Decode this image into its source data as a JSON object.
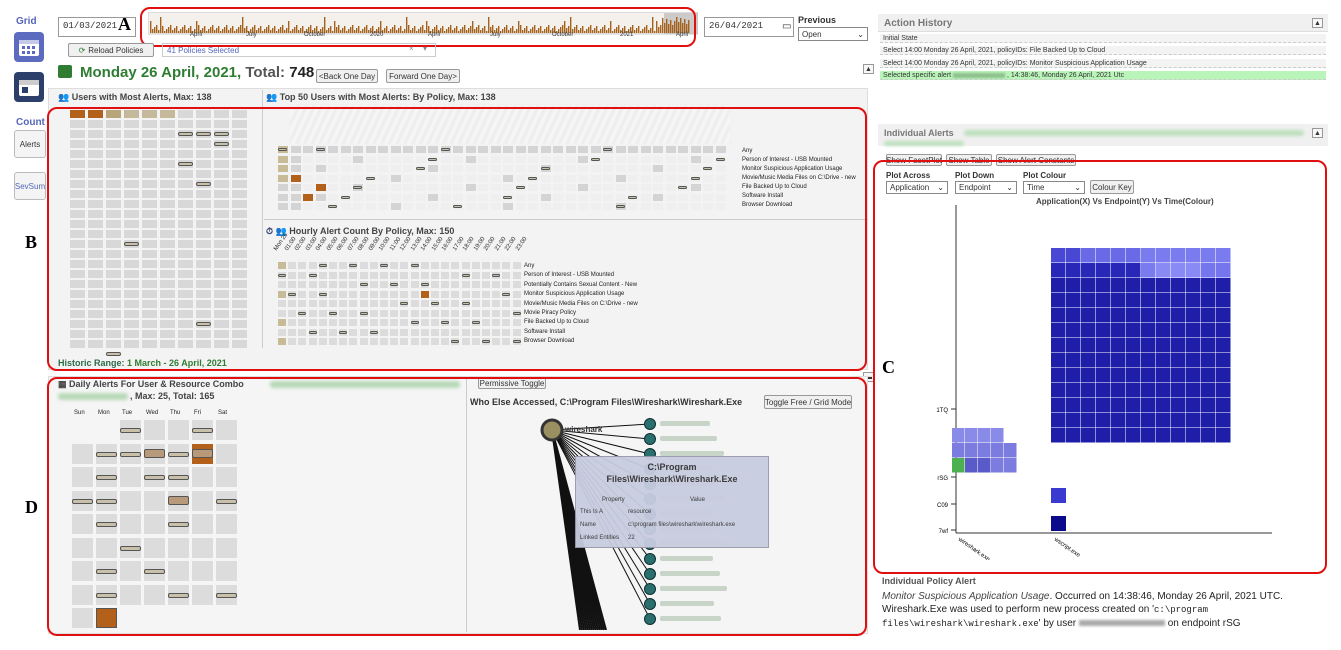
{
  "sidebar": {
    "grid_label": "Grid",
    "count_label": "Count",
    "alerts_label": "Alerts",
    "sevsum_label": "SevSum"
  },
  "timeline": {
    "start_date": "01/03/2021",
    "end_date": "26/04/2021",
    "marker_A": "A",
    "ticks": [
      "April",
      "July",
      "October",
      "2020",
      "April",
      "July",
      "October",
      "2021",
      "April"
    ],
    "previous_label": "Previous",
    "previous_value": "Open"
  },
  "toolbar": {
    "reload_label": "Reload Policies",
    "policies_selected": "41 Policies Selected",
    "clear_x": "×"
  },
  "day": {
    "title": "Monday 26 April, 2021,",
    "total_label": "Total:",
    "total": "748",
    "back_label": "<Back One Day",
    "forward_label": "Forward One Day>"
  },
  "panelB": {
    "marker": "B",
    "users_title": "Users with Most Alerts, Max:",
    "users_max": "138",
    "top50_title": "Top 50 Users with Most Alerts: By Policy, Max:",
    "top50_max": "138",
    "top50_policies": [
      "Any",
      "Person of Interest - USB Mounted",
      "Monitor Suspicious Application Usage",
      "Movie/Music Media Files on C:\\Drive - new",
      "File Backed Up to Cloud",
      "Software Install",
      "Browser Download"
    ],
    "hourly_title": "Hourly Alert Count By Policy, Max:",
    "hourly_max": "150",
    "hours": [
      "Mon 26",
      "01:00",
      "02:00",
      "03:00",
      "04:00",
      "05:00",
      "06:00",
      "07:00",
      "08:00",
      "09:00",
      "10:00",
      "11:00",
      "12:00",
      "13:00",
      "14:00",
      "15:00",
      "16:00",
      "17:00",
      "18:00",
      "19:00",
      "20:00",
      "21:00",
      "22:00",
      "23:00"
    ],
    "hourly_policies": [
      "Any",
      "Person of Interest - USB Mounted",
      "Potentially Contains Sexual Content - New",
      "Monitor Suspicious Application Usage",
      "Movie/Music Media Files on C:\\Drive - new",
      "Movie Piracy Policy",
      "File Backed Up to Cloud",
      "Software Install",
      "Browser Download"
    ],
    "historic_label": "Historic Range:",
    "historic_range": "1 March - 26 April, 2021"
  },
  "panelD": {
    "marker": "D",
    "title": "Daily Alerts For User & Resource Combo",
    "max_label": ", Max:",
    "max": "25",
    "total_label": ", Total:",
    "total": "165",
    "days": [
      "Sun",
      "Mon",
      "Tue",
      "Wed",
      "Thu",
      "Fri",
      "Sat"
    ],
    "permissive_label": "Permissive Toggle",
    "who_title": "Who Else Accessed, C:\\Program Files\\Wireshark\\Wireshark.Exe",
    "toggle_label": "Toggle Free / Grid Mode",
    "node_label": "wireshark",
    "tooltip": {
      "title": "C:\\Program Files\\Wireshark\\Wireshark.Exe",
      "prop_h": "Property",
      "val_h": "Value",
      "rows": [
        {
          "k": "This Is A",
          "v": "resource"
        },
        {
          "k": "Name",
          "v": "c:\\program files\\wireshark\\wireshark.exe"
        },
        {
          "k": "Linked Entities",
          "v": "22"
        }
      ]
    }
  },
  "history": {
    "title": "Action History",
    "items": [
      "Initial State",
      "Select 14:00 Monday 26 April, 2021, policyIDs: File Backed Up to Cloud",
      "Select 14:00 Monday 26 April, 2021, policyIDs: Monitor Suspicious Application Usage",
      "Selected specific alert",
      ", 14:38:46, Monday 26 April, 2021 Utc"
    ]
  },
  "individual": {
    "title": "Individual Alerts",
    "tabs": [
      "Show FacetPlot",
      "Show Table",
      "Show Alert Constants"
    ],
    "plot_across_label": "Plot Across",
    "plot_across": "Application",
    "plot_down_label": "Plot Down",
    "plot_down": "Endpoint",
    "plot_colour_label": "Plot Colour",
    "plot_colour": "Time",
    "colour_key": "Colour Key",
    "chart_title": "Application(X) Vs Endpoint(Y) Vs Time(Colour)",
    "y_ticks": [
      "1TQ",
      "rSG",
      "C09",
      "7wf"
    ],
    "x_ticks": [
      "wireshark.exe",
      "wscript.exe"
    ],
    "marker": "C"
  },
  "policy_alert": {
    "title": "Individual Policy Alert",
    "name": "Monitor Suspicious Application Usage",
    "occurred": ". Occurred on 14:38:46, Monday 26 April, 2021 UTC.",
    "line2": "Wireshark.Exe was used to perform new process created on '",
    "path": "c:\\program files\\wireshark\\wireshark.exe",
    "line3": "' by user",
    "line4": "on endpoint rSG"
  },
  "colors": {
    "accent": "#2e7d32",
    "red": "#e01010",
    "brown": "#b3601a",
    "tan": "#b8a57a",
    "navy": "#1a1aa0",
    "lavender": "#8080e8",
    "green": "#4caf50"
  }
}
